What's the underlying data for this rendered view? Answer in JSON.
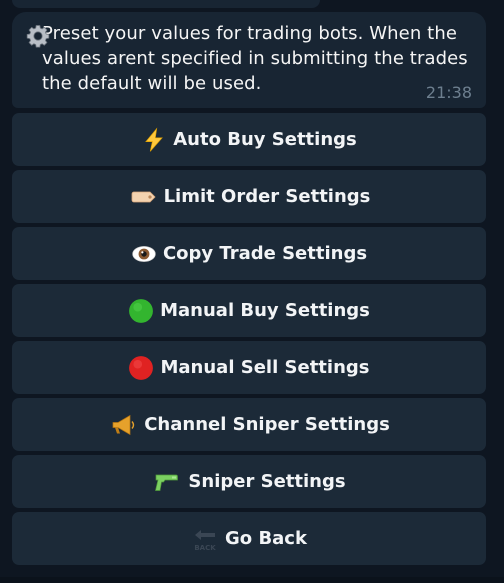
{
  "message": {
    "text": "Preset your values for trading bots. When the values arent specified in submitting the trades the default will be used.",
    "time": "21:38",
    "icon": "gear-icon"
  },
  "keyboard": {
    "buttons": [
      {
        "label": "Auto Buy Settings",
        "icon": "lightning-icon"
      },
      {
        "label": "Limit Order Settings",
        "icon": "tag-icon"
      },
      {
        "label": "Copy Trade Settings",
        "icon": "eye-icon"
      },
      {
        "label": "Manual Buy Settings",
        "icon": "green-circle-icon"
      },
      {
        "label": "Manual Sell Settings",
        "icon": "red-circle-icon"
      },
      {
        "label": "Channel Sniper Settings",
        "icon": "megaphone-icon"
      },
      {
        "label": "Sniper Settings",
        "icon": "water-pistol-icon"
      },
      {
        "label": "Go Back",
        "icon": "back-arrow-icon"
      }
    ]
  },
  "colors": {
    "background": "#0e1621",
    "bubble": "#182533",
    "button": "#1c2a38",
    "text": "#f2f4f6",
    "time": "#6d7f8f"
  }
}
